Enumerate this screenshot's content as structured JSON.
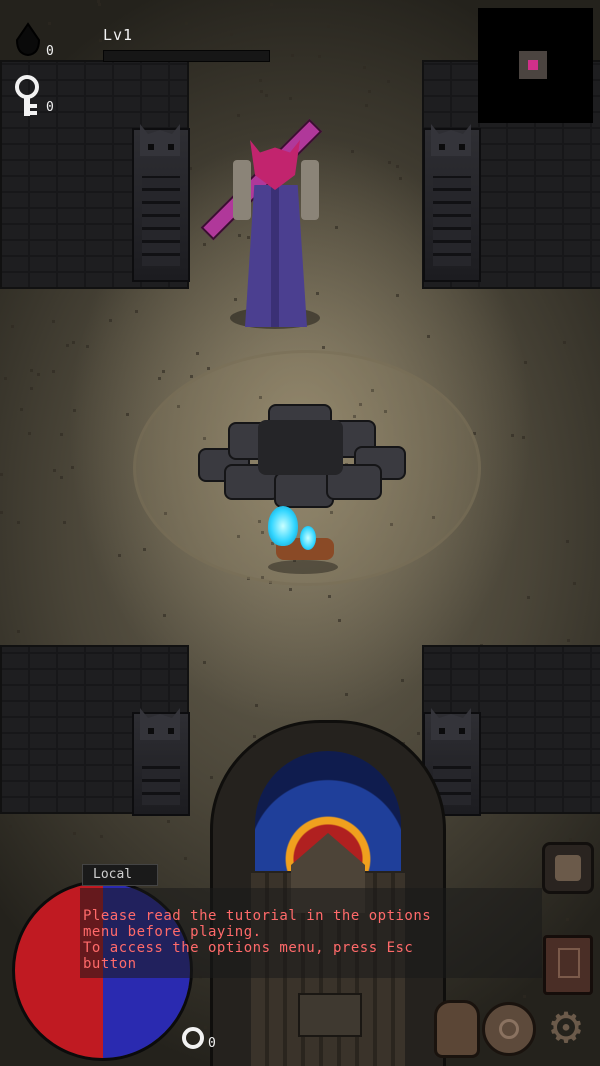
{
  "hud": {
    "level_label": "Lv1",
    "xp_fraction": 0.0,
    "soul_count": "0",
    "key_count": "0",
    "bottom_key_count": "0"
  },
  "chat": {
    "tab_label": "Local",
    "lines": [
      "Please read the tutorial in the options",
      "menu before playing.",
      "To access the options menu, press Esc",
      "button"
    ]
  },
  "status_orb": {
    "health_color": "#c01a22",
    "mana_color": "#2a2ab0"
  },
  "side_buttons": {
    "top_icon": "map-scroll-icon",
    "spellbook_icon": "spellbook-icon",
    "inventory_icon": "bag-icon",
    "compass_icon": "compass-icon",
    "settings_icon": "gear-icon"
  },
  "colors": {
    "boss_head": "#c2246e",
    "boss_robe": "#4b3f90",
    "player_flame": "#33d6ff",
    "chat_text": "#ff6a6a"
  }
}
